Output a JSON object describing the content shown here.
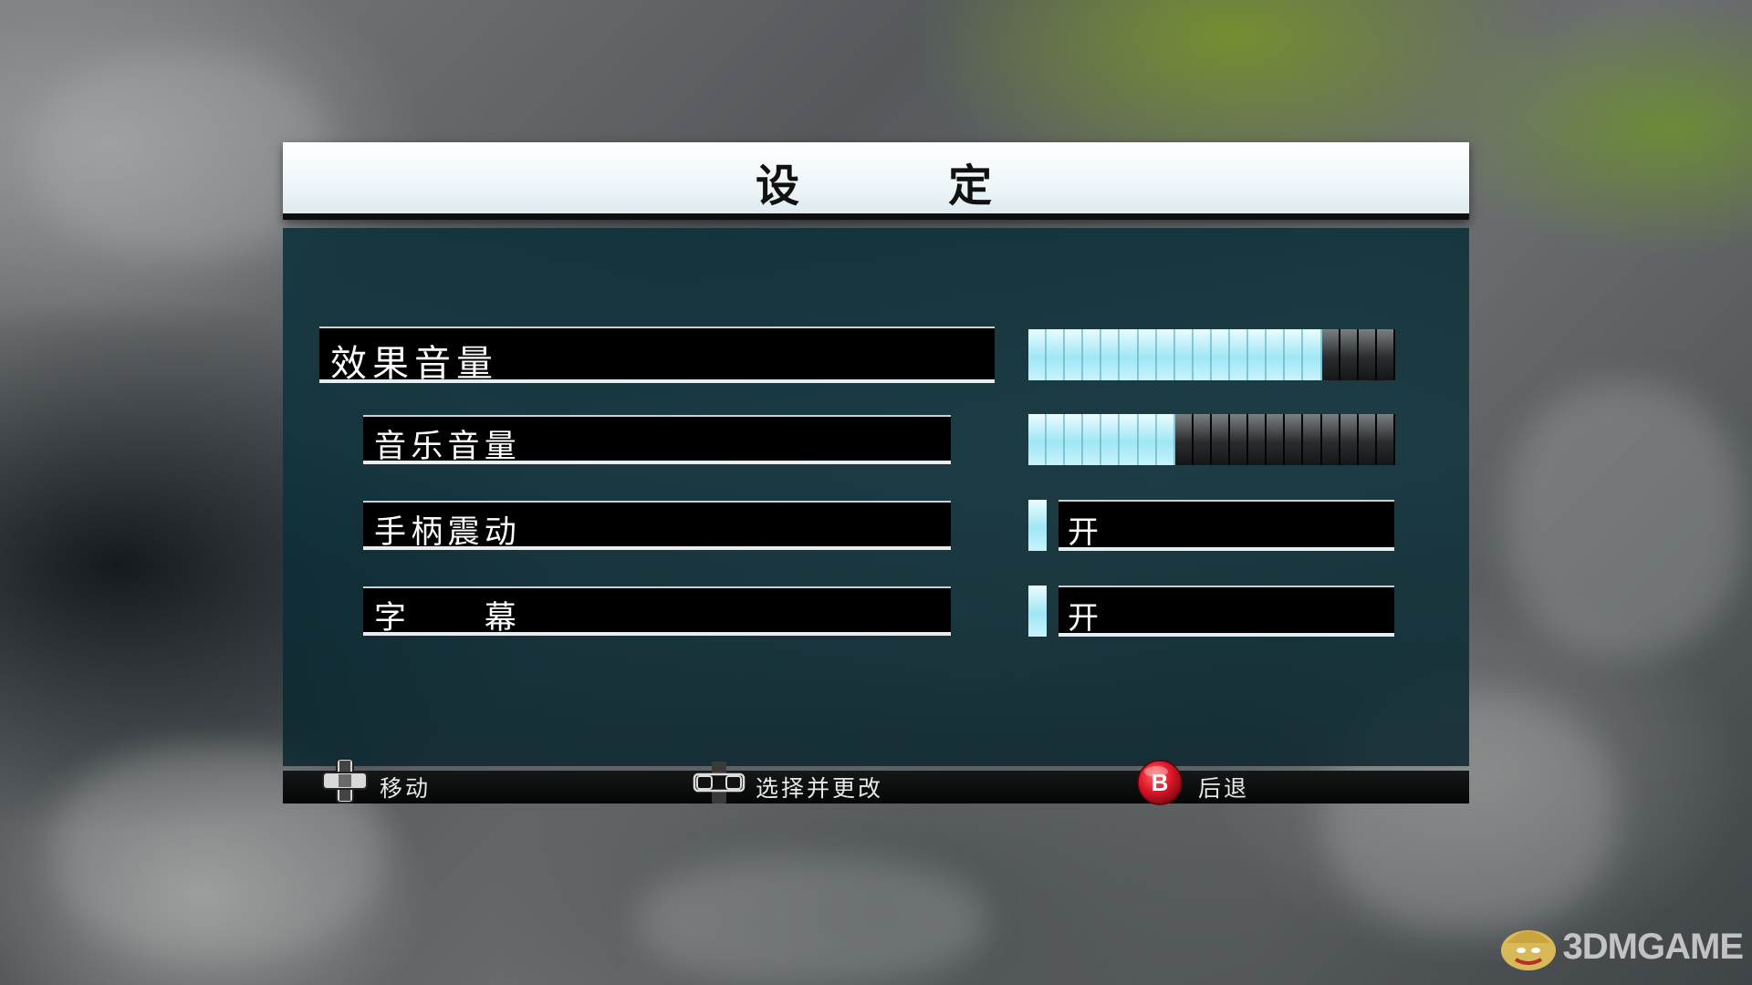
{
  "title": "设　　　定",
  "settings": [
    {
      "label": "效果音量",
      "type": "slider",
      "level": 16,
      "max": 20
    },
    {
      "label": "音乐音量",
      "type": "slider",
      "level": 8,
      "max": 20
    },
    {
      "label": "手柄震动",
      "type": "toggle",
      "value": "开"
    },
    {
      "label": "字　　幕",
      "type": "toggle",
      "value": "开"
    }
  ],
  "footer": {
    "move": "移动",
    "select_change": "选择并更改",
    "back": "后退",
    "b_button": "B"
  },
  "watermark": "3DMGAME",
  "colors": {
    "bar_on": "#aeeaf6",
    "bar_off": "#2a2d2f",
    "panel": "#0c3640",
    "b_button": "#e0182a"
  }
}
